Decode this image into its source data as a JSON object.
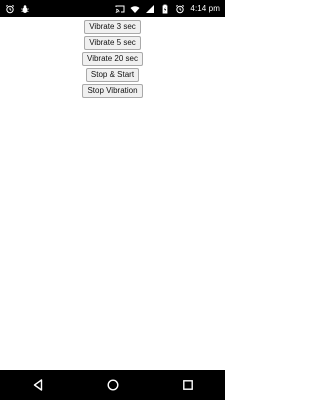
{
  "status_bar": {
    "left_icons": [
      "alarm-icon",
      "bug-icon"
    ],
    "right_icons": [
      "cast-icon",
      "wifi-icon",
      "signal-icon",
      "battery-icon",
      "alarm-icon"
    ],
    "time": "4:14 pm"
  },
  "buttons": [
    {
      "label": "Vibrate 3 sec"
    },
    {
      "label": "Vibrate 5 sec"
    },
    {
      "label": "Vibrate 20 sec"
    },
    {
      "label": "Stop & Start"
    },
    {
      "label": "Stop Vibration"
    }
  ],
  "navigation_bar": {
    "icons": [
      "back-icon",
      "home-icon",
      "recents-icon"
    ]
  }
}
